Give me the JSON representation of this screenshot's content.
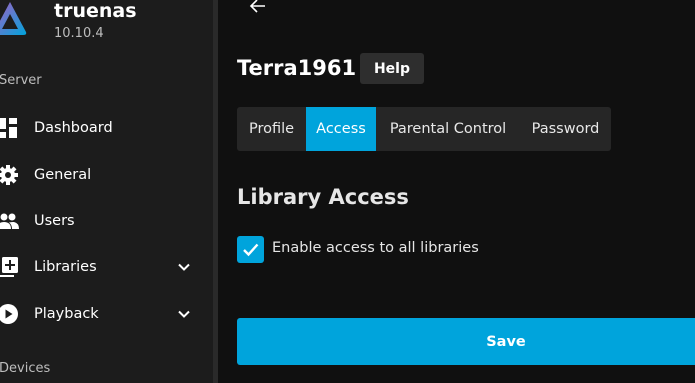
{
  "sidebar": {
    "server_name": "truenas",
    "server_version": "10.10.4",
    "sections": [
      {
        "title": "Server"
      },
      {
        "title": "Devices"
      }
    ],
    "items": [
      {
        "label": "Dashboard",
        "icon": "dashboard-icon"
      },
      {
        "label": "General",
        "icon": "gear-icon"
      },
      {
        "label": "Users",
        "icon": "people-icon"
      },
      {
        "label": "Libraries",
        "icon": "library-add-icon",
        "expandable": true
      },
      {
        "label": "Playback",
        "icon": "play-circle-icon",
        "expandable": true
      }
    ]
  },
  "main": {
    "back_icon": "arrow-left-icon",
    "user_title": "Terra1961",
    "help_label": "Help",
    "tabs": [
      {
        "label": "Profile",
        "active": false
      },
      {
        "label": "Access",
        "active": true
      },
      {
        "label": "Parental Control",
        "active": false
      },
      {
        "label": "Password",
        "active": false
      }
    ],
    "section_heading": "Library Access",
    "enable_all_libraries": {
      "label": "Enable access to all libraries",
      "checked": true
    },
    "save_label": "Save"
  },
  "colors": {
    "accent": "#00a4dc",
    "sidebar_bg": "#1c1c1c",
    "main_bg": "#101010",
    "tab_bg": "#262626",
    "help_bg": "#2e2e2e"
  }
}
